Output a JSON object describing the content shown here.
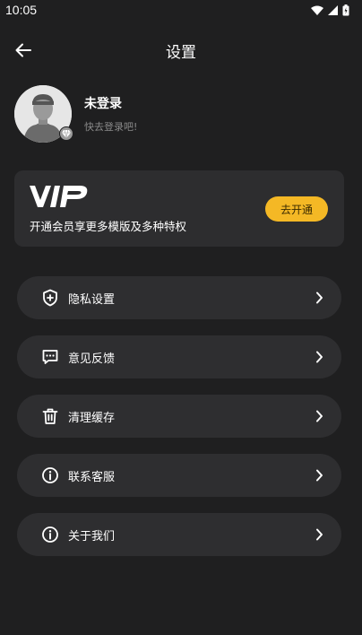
{
  "status_bar": {
    "time": "10:05"
  },
  "app_bar": {
    "title": "设置"
  },
  "profile": {
    "name": "未登录",
    "subtitle": "快去登录吧!"
  },
  "vip": {
    "logo_text": "VIP",
    "description": "开通会员享更多模版及多种特权",
    "button_label": "去开通",
    "accent_color": "#f4b825"
  },
  "menu": {
    "items": [
      {
        "label": "隐私设置",
        "icon": "shield-icon"
      },
      {
        "label": "意见反馈",
        "icon": "feedback-icon"
      },
      {
        "label": "清理缓存",
        "icon": "trash-icon"
      },
      {
        "label": "联系客服",
        "icon": "info-icon"
      },
      {
        "label": "关于我们",
        "icon": "info-icon"
      }
    ]
  }
}
